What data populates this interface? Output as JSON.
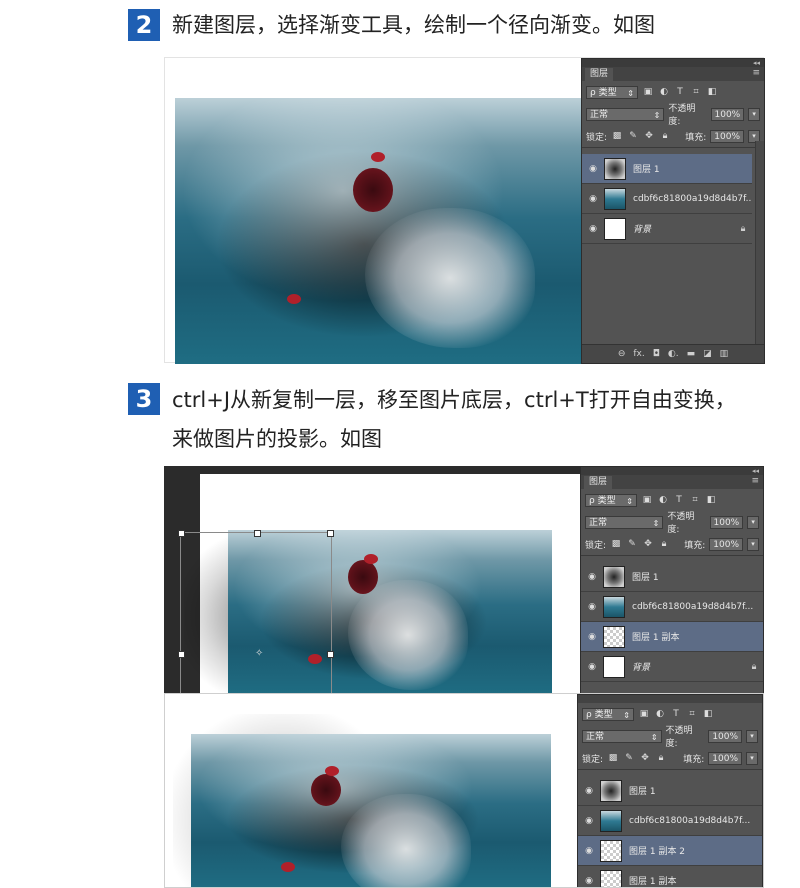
{
  "steps": [
    {
      "number": "2",
      "text_line1": "新建图层，选择渐变工具，绘制一个径向渐变。如图"
    },
    {
      "number": "3",
      "text_line1": "ctrl+J从新复制一层，移至图片底层，ctrl+T打开自由变换，",
      "text_line2": "来做图片的投影。如图"
    }
  ],
  "panel": {
    "tab_label": "图层",
    "filter_label": "ρ 类型",
    "blend_mode": "正常",
    "opacity_label": "不透明度:",
    "opacity_value": "100%",
    "lock_label": "锁定:",
    "fill_label": "填充:",
    "fill_value": "100%",
    "collapse_glyph": "◂◂",
    "close_glyph": "✕",
    "menu_glyph": "≡",
    "bottom_icons": "⊖  fx.  ◘  ◐.  ▬  ◪  🗑"
  },
  "panel_a_layers": [
    {
      "name": "图层 1",
      "thumb": "grad",
      "selected": true
    },
    {
      "name": "cdbf6c81800a19d8d4b7f...",
      "thumb": "photo-t",
      "selected": false
    },
    {
      "name": "背景",
      "thumb": "white",
      "selected": false,
      "locked": true
    }
  ],
  "panel_b_layers": [
    {
      "name": "图层 1",
      "thumb": "grad",
      "selected": false
    },
    {
      "name": "cdbf6c81800a19d8d4b7f...",
      "thumb": "photo-t",
      "selected": false
    },
    {
      "name": "图层 1 副本",
      "thumb": "checker",
      "selected": true
    },
    {
      "name": "背景",
      "thumb": "white",
      "selected": false,
      "locked": true
    }
  ],
  "panel_c_layers": [
    {
      "name": "图层 1",
      "thumb": "grad",
      "selected": false
    },
    {
      "name": "cdbf6c81800a19d8d4b7f...",
      "thumb": "photo-t",
      "selected": false
    },
    {
      "name": "图层 1 副本 2",
      "thumb": "checker",
      "selected": true
    },
    {
      "name": "图层 1 副本",
      "thumb": "checker",
      "selected": false
    }
  ],
  "icons": {
    "eye": "👁",
    "lock": "🔒"
  }
}
